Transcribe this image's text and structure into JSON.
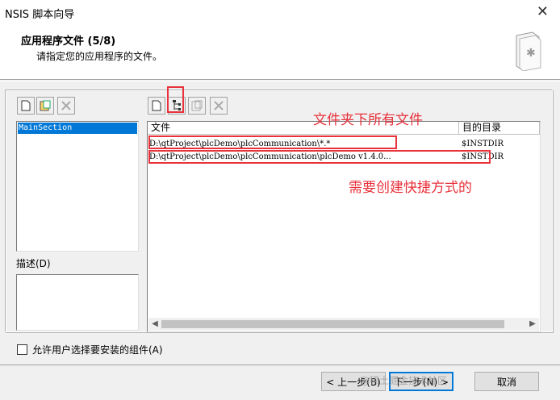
{
  "window": {
    "title": "NSIS 脚本向导",
    "close_glyph": "✕"
  },
  "header": {
    "title": "应用程序文件 (5/8)",
    "subtitle": "请指定您的应用程序的文件。",
    "icon": "document-asterisk-icon"
  },
  "sections": {
    "items": [
      "MainSection"
    ],
    "description_label": "描述(D)"
  },
  "files": {
    "columns": [
      "文件",
      "目的目录"
    ],
    "rows": [
      {
        "file": "D:\\qtProject\\plcDemo\\plcCommunication\\*.*",
        "dest": "$INSTDIR"
      },
      {
        "file": "D:\\qtProject\\plcDemo\\plcCommunication\\plcDemo v1.4.0...",
        "dest": "$INSTDIR"
      }
    ]
  },
  "annotations": {
    "folder_files": "文件夹下所有文件",
    "shortcut_needed": "需要创建快捷方式的"
  },
  "options": {
    "allow_select_components": "允许用户选择要安装的组件(A)"
  },
  "buttons": {
    "back": "< 上一步(B)",
    "next": "下一步(N) >",
    "cancel": "取消"
  },
  "watermark": "@稀土掘金技术社区",
  "colors": {
    "annotation_red": "#e8323c",
    "selection_blue": "#0078d7"
  }
}
